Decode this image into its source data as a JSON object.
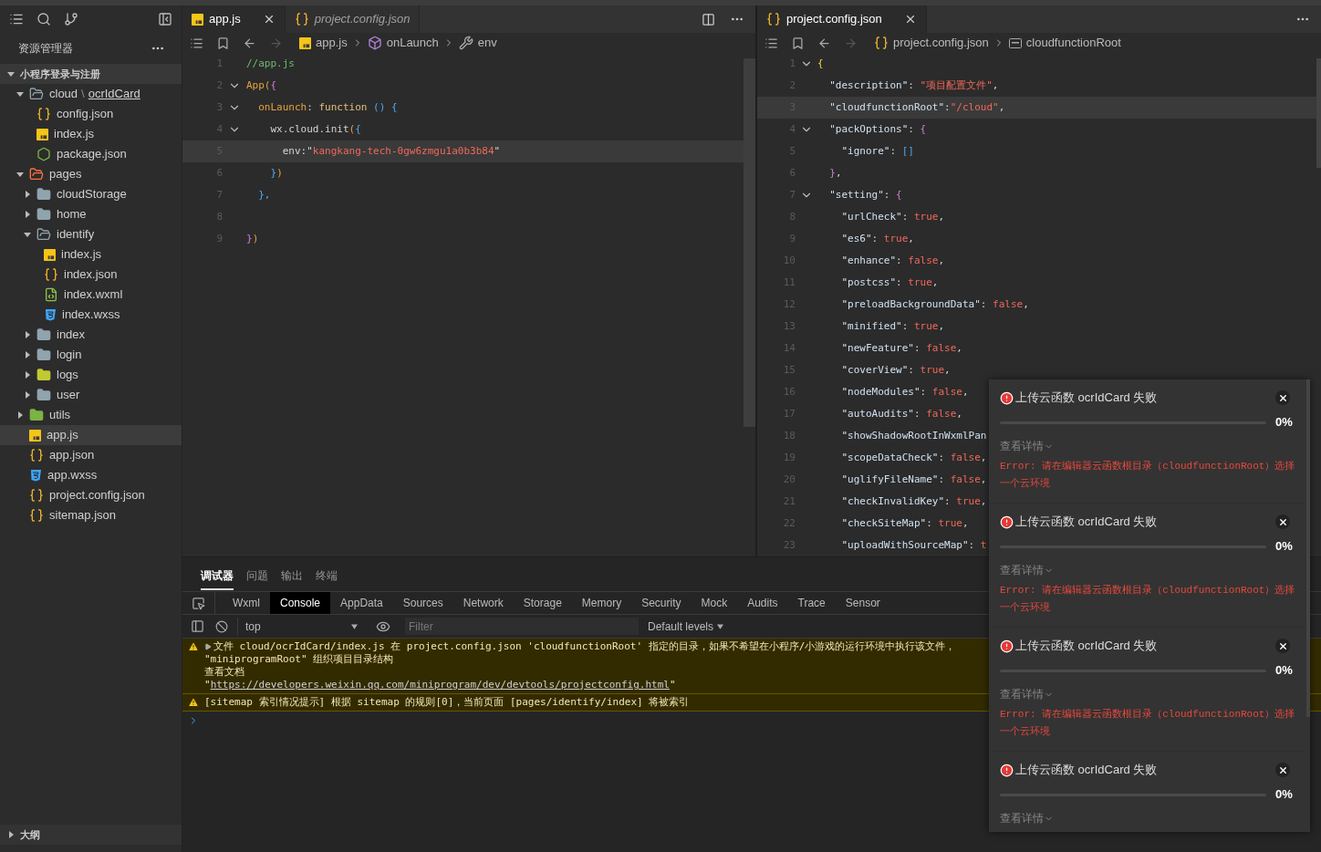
{
  "sidebar": {
    "title": "资源管理器",
    "project": {
      "label": "小程序登录与注册",
      "expanded": true
    },
    "tree": [
      {
        "label": "cloud",
        "separator": "\\",
        "link": "ocrIdCard",
        "kind": "folder",
        "expanded": true,
        "selected": false,
        "children": [
          {
            "label": "config.json",
            "kind": "json",
            "selected": false
          },
          {
            "label": "index.js",
            "kind": "js",
            "selected": false
          },
          {
            "label": "package.json",
            "kind": "node",
            "selected": false
          }
        ]
      },
      {
        "label": "pages",
        "kind": "folder-pages",
        "expanded": true,
        "selected": false,
        "children": [
          {
            "label": "cloudStorage",
            "kind": "folder",
            "expanded": false,
            "selected": false
          },
          {
            "label": "home",
            "kind": "folder",
            "expanded": false,
            "selected": false
          },
          {
            "label": "identify",
            "kind": "folder",
            "expanded": true,
            "selected": false,
            "children": [
              {
                "label": "index.js",
                "kind": "js",
                "selected": false
              },
              {
                "label": "index.json",
                "kind": "json",
                "selected": false
              },
              {
                "label": "index.wxml",
                "kind": "wxml",
                "selected": false
              },
              {
                "label": "index.wxss",
                "kind": "wxss",
                "selected": false
              }
            ]
          },
          {
            "label": "index",
            "kind": "folder",
            "expanded": false,
            "selected": false
          },
          {
            "label": "login",
            "kind": "folder",
            "expanded": false,
            "selected": false
          },
          {
            "label": "logs",
            "kind": "folder-logs",
            "expanded": false,
            "selected": false
          },
          {
            "label": "user",
            "kind": "folder",
            "expanded": false,
            "selected": false
          }
        ]
      },
      {
        "label": "utils",
        "kind": "folder-utils",
        "expanded": false,
        "selected": false
      },
      {
        "label": "app.js",
        "kind": "js",
        "selected": true
      },
      {
        "label": "app.json",
        "kind": "json",
        "selected": false
      },
      {
        "label": "app.wxss",
        "kind": "wxss",
        "selected": false
      },
      {
        "label": "project.config.json",
        "kind": "json",
        "selected": false
      },
      {
        "label": "sitemap.json",
        "kind": "json",
        "selected": false
      }
    ],
    "outline": {
      "label": "大纲",
      "expanded": false
    }
  },
  "editors": [
    {
      "tabs": [
        {
          "label": "app.js",
          "kind": "js",
          "selected": true,
          "preview": false,
          "closable": true
        },
        {
          "label": "project.config.json",
          "kind": "json",
          "selected": false,
          "preview": true,
          "closable": false
        }
      ],
      "breadcrumbs": [
        {
          "label": "app.js",
          "kind": "js"
        },
        {
          "label": "onLaunch",
          "kind": "cube"
        },
        {
          "label": "env",
          "kind": "wrench"
        }
      ],
      "lines": [
        {
          "number": "1",
          "fold": false,
          "highlighted": false,
          "tokens": [
            {
              "text": "//app.js",
              "kind": "comment"
            }
          ]
        },
        {
          "number": "2",
          "fold": true,
          "highlighted": false,
          "tokens": [
            {
              "text": "App(",
              "kind": "fn"
            },
            {
              "text": "{",
              "kind": "bracket2"
            }
          ]
        },
        {
          "number": "3",
          "fold": true,
          "highlighted": false,
          "tokens": [
            {
              "text": "  onLaunch",
              "kind": "key"
            },
            {
              "text": ": ",
              "kind": "plain"
            },
            {
              "text": "function",
              "kind": "keyword"
            },
            {
              "text": " () {",
              "kind": "bracket3"
            }
          ]
        },
        {
          "number": "4",
          "fold": true,
          "highlighted": false,
          "tokens": [
            {
              "text": "    wx.cloud.init",
              "kind": "plain"
            },
            {
              "text": "(",
              "kind": "fn"
            },
            {
              "text": "{",
              "kind": "bracket3"
            }
          ]
        },
        {
          "number": "5",
          "fold": false,
          "highlighted": true,
          "tokens": [
            {
              "text": "      env:\"",
              "kind": "plain"
            },
            {
              "text": "kangkang-tech-0gw6zmgu1a0b3b84",
              "kind": "string"
            },
            {
              "text": "\"",
              "kind": "plain"
            }
          ]
        },
        {
          "number": "6",
          "fold": false,
          "highlighted": false,
          "tokens": [
            {
              "text": "    }",
              "kind": "bracket3"
            },
            {
              "text": ")",
              "kind": "fn"
            }
          ]
        },
        {
          "number": "7",
          "fold": false,
          "highlighted": false,
          "tokens": [
            {
              "text": "  },",
              "kind": "bracket3"
            }
          ]
        },
        {
          "number": "8",
          "fold": false,
          "highlighted": false
        },
        {
          "number": "9",
          "fold": false,
          "highlighted": false,
          "tokens": [
            {
              "text": "}",
              "kind": "bracket2"
            },
            {
              "text": ")",
              "kind": "fn"
            }
          ]
        }
      ]
    },
    {
      "tabs": [
        {
          "label": "project.config.json",
          "kind": "json",
          "selected": true,
          "preview": false,
          "closable": true
        }
      ],
      "breadcrumbs": [
        {
          "label": "project.config.json",
          "kind": "json"
        },
        {
          "label": "cloudfunctionRoot",
          "kind": "field"
        }
      ],
      "lines": [
        {
          "number": "1",
          "fold": true,
          "highlighted": false,
          "tokens": [
            {
              "text": "{",
              "kind": "bracket1"
            }
          ]
        },
        {
          "number": "2",
          "fold": false,
          "highlighted": false,
          "tokens": [
            {
              "text": "  \"description\"",
              "kind": "jsonkey"
            },
            {
              "text": ": ",
              "kind": "plain"
            },
            {
              "text": "\"项目配置文件\"",
              "kind": "string"
            },
            {
              "text": ",",
              "kind": "plain"
            }
          ]
        },
        {
          "number": "3",
          "fold": false,
          "highlighted": true,
          "tokens": [
            {
              "text": "  \"cloudfunctionRoot\"",
              "kind": "jsonkey"
            },
            {
              "text": ":",
              "kind": "plain"
            },
            {
              "text": "\"/cloud\"",
              "kind": "string"
            },
            {
              "text": ",",
              "kind": "plain"
            }
          ]
        },
        {
          "number": "4",
          "fold": true,
          "highlighted": false,
          "tokens": [
            {
              "text": "  \"packOptions\"",
              "kind": "jsonkey"
            },
            {
              "text": ": ",
              "kind": "plain"
            },
            {
              "text": "{",
              "kind": "bracket2"
            }
          ]
        },
        {
          "number": "5",
          "fold": false,
          "highlighted": false,
          "tokens": [
            {
              "text": "    \"ignore\"",
              "kind": "jsonkey"
            },
            {
              "text": ": ",
              "kind": "plain"
            },
            {
              "text": "[]",
              "kind": "bracket3"
            }
          ]
        },
        {
          "number": "6",
          "fold": false,
          "highlighted": false,
          "tokens": [
            {
              "text": "  }",
              "kind": "bracket2"
            },
            {
              "text": ",",
              "kind": "plain"
            }
          ]
        },
        {
          "number": "7",
          "fold": true,
          "highlighted": false,
          "tokens": [
            {
              "text": "  \"setting\"",
              "kind": "jsonkey"
            },
            {
              "text": ": ",
              "kind": "plain"
            },
            {
              "text": "{",
              "kind": "bracket2"
            }
          ]
        },
        {
          "number": "8",
          "fold": false,
          "highlighted": false,
          "tokens": [
            {
              "text": "    \"urlCheck\"",
              "kind": "jsonkey"
            },
            {
              "text": ": ",
              "kind": "plain"
            },
            {
              "text": "true",
              "kind": "bool"
            },
            {
              "text": ",",
              "kind": "plain"
            }
          ]
        },
        {
          "number": "9",
          "fold": false,
          "highlighted": false,
          "tokens": [
            {
              "text": "    \"es6\"",
              "kind": "jsonkey"
            },
            {
              "text": ": ",
              "kind": "plain"
            },
            {
              "text": "true",
              "kind": "bool"
            },
            {
              "text": ",",
              "kind": "plain"
            }
          ]
        },
        {
          "number": "10",
          "fold": false,
          "highlighted": false,
          "tokens": [
            {
              "text": "    \"enhance\"",
              "kind": "jsonkey"
            },
            {
              "text": ": ",
              "kind": "plain"
            },
            {
              "text": "false",
              "kind": "bool"
            },
            {
              "text": ",",
              "kind": "plain"
            }
          ]
        },
        {
          "number": "11",
          "fold": false,
          "highlighted": false,
          "tokens": [
            {
              "text": "    \"postcss\"",
              "kind": "jsonkey"
            },
            {
              "text": ": ",
              "kind": "plain"
            },
            {
              "text": "true",
              "kind": "bool"
            },
            {
              "text": ",",
              "kind": "plain"
            }
          ]
        },
        {
          "number": "12",
          "fold": false,
          "highlighted": false,
          "tokens": [
            {
              "text": "    \"preloadBackgroundData\"",
              "kind": "jsonkey"
            },
            {
              "text": ": ",
              "kind": "plain"
            },
            {
              "text": "false",
              "kind": "bool"
            },
            {
              "text": ",",
              "kind": "plain"
            }
          ]
        },
        {
          "number": "13",
          "fold": false,
          "highlighted": false,
          "tokens": [
            {
              "text": "    \"minified\"",
              "kind": "jsonkey"
            },
            {
              "text": ": ",
              "kind": "plain"
            },
            {
              "text": "true",
              "kind": "bool"
            },
            {
              "text": ",",
              "kind": "plain"
            }
          ]
        },
        {
          "number": "14",
          "fold": false,
          "highlighted": false,
          "tokens": [
            {
              "text": "    \"newFeature\"",
              "kind": "jsonkey"
            },
            {
              "text": ": ",
              "kind": "plain"
            },
            {
              "text": "false",
              "kind": "bool"
            },
            {
              "text": ",",
              "kind": "plain"
            }
          ]
        },
        {
          "number": "15",
          "fold": false,
          "highlighted": false,
          "tokens": [
            {
              "text": "    \"coverView\"",
              "kind": "jsonkey"
            },
            {
              "text": ": ",
              "kind": "plain"
            },
            {
              "text": "true",
              "kind": "bool"
            },
            {
              "text": ",",
              "kind": "plain"
            }
          ]
        },
        {
          "number": "16",
          "fold": false,
          "highlighted": false,
          "tokens": [
            {
              "text": "    \"nodeModules\"",
              "kind": "jsonkey"
            },
            {
              "text": ": ",
              "kind": "plain"
            },
            {
              "text": "false",
              "kind": "bool"
            },
            {
              "text": ",",
              "kind": "plain"
            }
          ]
        },
        {
          "number": "17",
          "fold": false,
          "highlighted": false,
          "tokens": [
            {
              "text": "    \"autoAudits\"",
              "kind": "jsonkey"
            },
            {
              "text": ": ",
              "kind": "plain"
            },
            {
              "text": "false",
              "kind": "bool"
            },
            {
              "text": ",",
              "kind": "plain"
            }
          ]
        },
        {
          "number": "18",
          "fold": false,
          "highlighted": false,
          "tokens": [
            {
              "text": "    \"showShadowRootInWxmlPan",
              "kind": "jsonkey"
            }
          ]
        },
        {
          "number": "19",
          "fold": false,
          "highlighted": false,
          "tokens": [
            {
              "text": "    \"scopeDataCheck\"",
              "kind": "jsonkey"
            },
            {
              "text": ": ",
              "kind": "plain"
            },
            {
              "text": "false",
              "kind": "bool"
            },
            {
              "text": ",",
              "kind": "plain"
            }
          ]
        },
        {
          "number": "20",
          "fold": false,
          "highlighted": false,
          "tokens": [
            {
              "text": "    \"uglifyFileName\"",
              "kind": "jsonkey"
            },
            {
              "text": ": ",
              "kind": "plain"
            },
            {
              "text": "false",
              "kind": "bool"
            },
            {
              "text": ",",
              "kind": "plain"
            }
          ]
        },
        {
          "number": "21",
          "fold": false,
          "highlighted": false,
          "tokens": [
            {
              "text": "    \"checkInvalidKey\"",
              "kind": "jsonkey"
            },
            {
              "text": ": ",
              "kind": "plain"
            },
            {
              "text": "true",
              "kind": "bool"
            },
            {
              "text": ",",
              "kind": "plain"
            }
          ]
        },
        {
          "number": "22",
          "fold": false,
          "highlighted": false,
          "tokens": [
            {
              "text": "    \"checkSiteMap\"",
              "kind": "jsonkey"
            },
            {
              "text": ": ",
              "kind": "plain"
            },
            {
              "text": "true",
              "kind": "bool"
            },
            {
              "text": ",",
              "kind": "plain"
            }
          ]
        },
        {
          "number": "23",
          "fold": false,
          "highlighted": false,
          "tokens": [
            {
              "text": "    \"uploadWithSourceMap\"",
              "kind": "jsonkey"
            },
            {
              "text": ": ",
              "kind": "plain"
            },
            {
              "text": "t",
              "kind": "bool"
            }
          ]
        }
      ]
    }
  ],
  "panel": {
    "tabs": [
      {
        "label": "调试器",
        "selected": true
      },
      {
        "label": "问题",
        "selected": false
      },
      {
        "label": "输出",
        "selected": false
      },
      {
        "label": "终端",
        "selected": false
      }
    ],
    "devtools_tabs": [
      {
        "label": "Wxml",
        "selected": false
      },
      {
        "label": "Console",
        "selected": true
      },
      {
        "label": "AppData",
        "selected": false
      },
      {
        "label": "Sources",
        "selected": false
      },
      {
        "label": "Network",
        "selected": false
      },
      {
        "label": "Storage",
        "selected": false
      },
      {
        "label": "Memory",
        "selected": false
      },
      {
        "label": "Security",
        "selected": false
      },
      {
        "label": "Mock",
        "selected": false
      },
      {
        "label": "Audits",
        "selected": false
      },
      {
        "label": "Trace",
        "selected": false
      },
      {
        "label": "Sensor",
        "selected": false
      }
    ],
    "console_toolbar": {
      "context": "top",
      "filter_placeholder": "Filter",
      "levels": "Default levels"
    },
    "messages": [
      {
        "kind": "warning",
        "expanded": false,
        "lines": [
          "文件 cloud/ocrIdCard/index.js 在 project.config.json 'cloudfunctionRoot' 指定的目录，如果不希望在小程序/小游戏的运行环境中执行该文件，",
          "\"miniprogramRoot\" 组织项目目录结构",
          "查看文档"
        ],
        "link": {
          "before": "\"",
          "url": "https://developers.weixin.qq.com/miniprogram/dev/devtools/projectconfig.html",
          "after": "\""
        }
      },
      {
        "kind": "warning",
        "lines": [
          "[sitemap 索引情况提示] 根据 sitemap 的规则[0]，当前页面 [pages/identify/index] 将被索引"
        ]
      }
    ]
  },
  "notifications": [
    {
      "title": "上传云函数 ocrIdCard 失败",
      "level": 0,
      "percent": "0%",
      "details": "查看详情",
      "error": "Error: 请在编辑器云函数根目录（cloudfunctionRoot）选择一个云环境"
    },
    {
      "title": "上传云函数 ocrIdCard 失败",
      "level": 0,
      "percent": "0%",
      "details": "查看详情",
      "error": "Error: 请在编辑器云函数根目录（cloudfunctionRoot）选择一个云环境"
    },
    {
      "title": "上传云函数 ocrIdCard 失败",
      "level": 0,
      "percent": "0%",
      "details": "查看详情",
      "error": "Error: 请在编辑器云函数根目录（cloudfunctionRoot）选择一个云环境"
    },
    {
      "title": "上传云函数 ocrIdCard 失败",
      "level": 0,
      "percent": "0%",
      "details": "查看详情"
    }
  ]
}
